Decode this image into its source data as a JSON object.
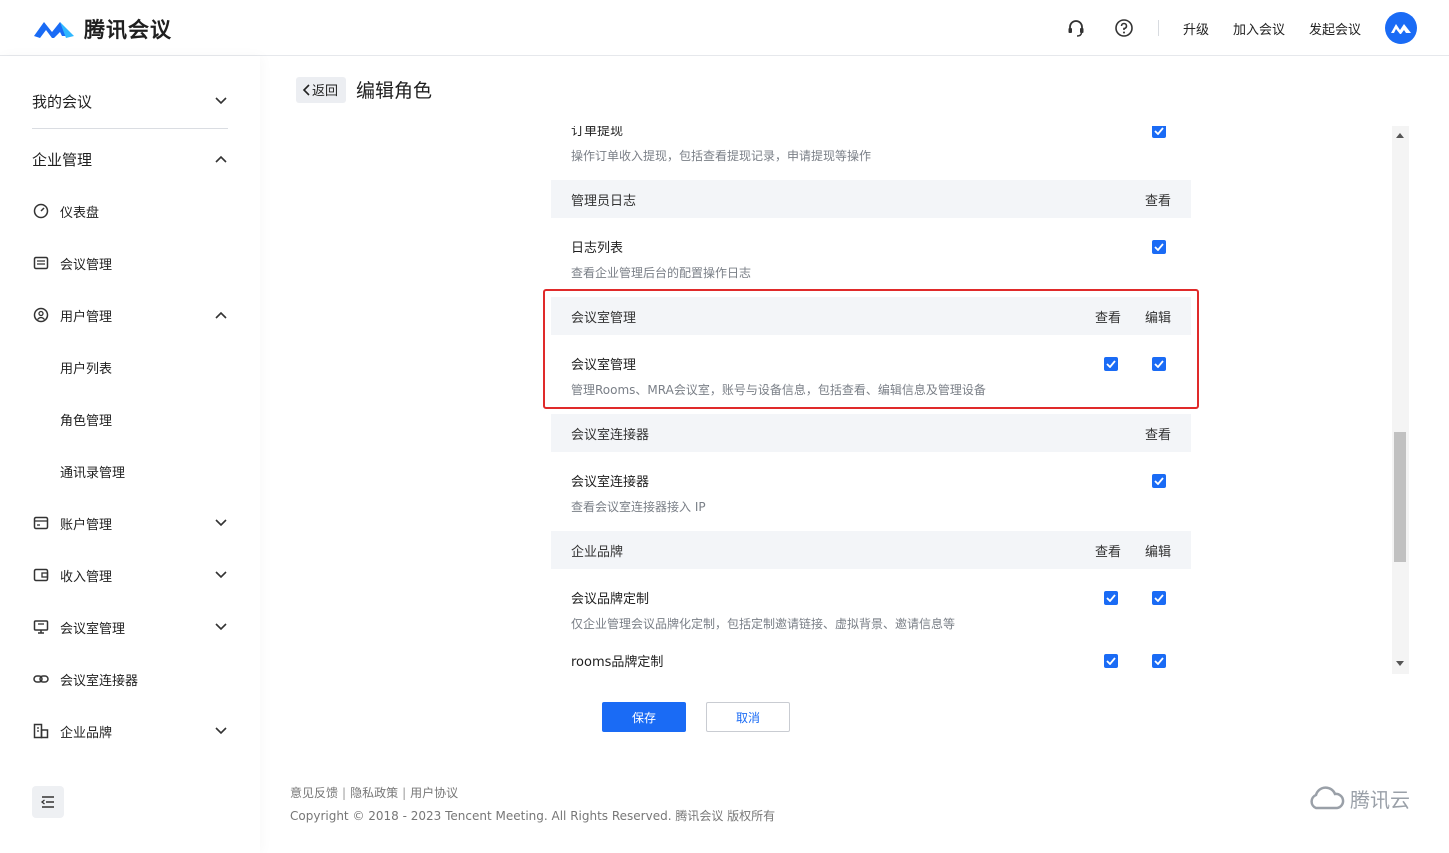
{
  "app": {
    "brand": "腾讯会议"
  },
  "header": {
    "upgrade": "升级",
    "join": "加入会议",
    "start": "发起会议"
  },
  "sidebar": {
    "my_meetings": "我的会议",
    "enterprise": "企业管理",
    "items": [
      {
        "label": "仪表盘",
        "icon": "dashboard-icon"
      },
      {
        "label": "会议管理",
        "icon": "list-icon"
      },
      {
        "label": "用户管理",
        "icon": "user-icon"
      },
      {
        "label": "用户列表"
      },
      {
        "label": "角色管理"
      },
      {
        "label": "通讯录管理"
      },
      {
        "label": "账户管理",
        "icon": "wallet-icon"
      },
      {
        "label": "收入管理",
        "icon": "income-icon"
      },
      {
        "label": "会议室管理",
        "icon": "room-icon"
      },
      {
        "label": "会议室连接器",
        "icon": "link-icon"
      },
      {
        "label": "企业品牌",
        "icon": "brand-icon"
      }
    ]
  },
  "page": {
    "back": "返回",
    "title": "编辑角色"
  },
  "sections": {
    "s0": {
      "row_title": "订单提现",
      "row_desc": "操作订单收入提现，包括查看提现记录，申请提现等操作"
    },
    "s1": {
      "head": "管理员日志",
      "view": "查看",
      "row_title": "日志列表",
      "row_desc": "查看企业管理后台的配置操作日志"
    },
    "s2": {
      "head": "会议室管理",
      "view": "查看",
      "edit": "编辑",
      "row_title": "会议室管理",
      "row_desc": "管理Rooms、MRA会议室，账号与设备信息，包括查看、编辑信息及管理设备"
    },
    "s3": {
      "head": "会议室连接器",
      "view": "查看",
      "row_title": "会议室连接器",
      "row_desc": "查看会议室连接器接入 IP"
    },
    "s4": {
      "head": "企业品牌",
      "view": "查看",
      "edit": "编辑",
      "row_title": "会议品牌定制",
      "row_desc": "仅企业管理会议品牌化定制，包括定制邀请链接、虚拟背景、邀请信息等",
      "row2_title": "rooms品牌定制"
    }
  },
  "actions": {
    "save": "保存",
    "cancel": "取消"
  },
  "footer": {
    "feedback": "意见反馈",
    "privacy": "隐私政策",
    "agreement": "用户协议",
    "copyright": "Copyright © 2018 - 2023 Tencent Meeting. All Rights Reserved. 腾讯会议 版权所有",
    "cloud": "腾讯云"
  },
  "colors": {
    "accent": "#1a6bf5",
    "highlight": "#e02a2a"
  }
}
